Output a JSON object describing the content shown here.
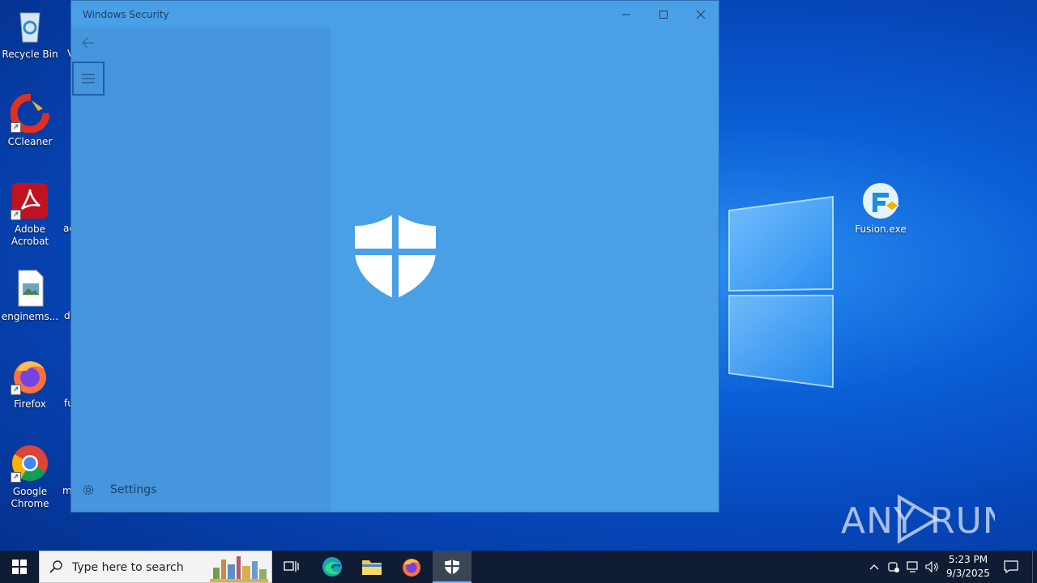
{
  "desktop": {
    "icons": [
      {
        "label": "Recycle Bin"
      },
      {
        "label": "CCleaner"
      },
      {
        "label": "Adobe Acrobat"
      },
      {
        "label": "enginems..."
      },
      {
        "label": "Firefox"
      },
      {
        "label": "Google Chrome"
      }
    ],
    "cut_labels": [
      "V",
      "ac",
      "d",
      "fu",
      "m"
    ],
    "right_icon": {
      "label": "Fusion.exe"
    },
    "watermark": "ANY RUN"
  },
  "window": {
    "title": "Windows Security",
    "nav": {
      "settings_label": "Settings"
    }
  },
  "taskbar": {
    "search_placeholder": "Type here to search",
    "time": "5:23 PM",
    "date": "9/3/2025"
  },
  "colors": {
    "window_bg": "#4aa0e6",
    "nav_bg": "#4596dc",
    "taskbar": "#0f1c33"
  }
}
